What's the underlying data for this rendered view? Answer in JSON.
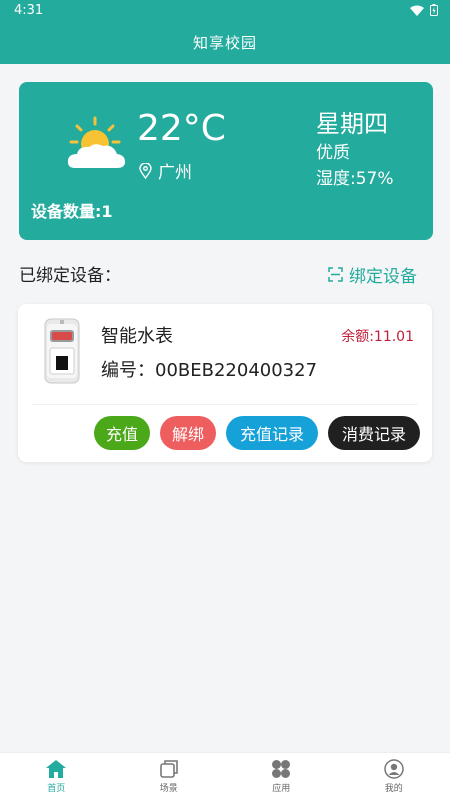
{
  "status_bar": {
    "time": "4:31"
  },
  "app": {
    "title": "知享校园"
  },
  "weather": {
    "temperature": "22°C",
    "location": "广州",
    "weekday": "星期四",
    "air_quality": "优质",
    "humidity": "湿度:57%",
    "device_count": "设备数量:1"
  },
  "bound_section": {
    "title": "已绑定设备：",
    "bind_label": "绑定设备"
  },
  "device": {
    "name": "智能水表",
    "balance": "余额:11.01",
    "serial": "编号：00BEB220400327",
    "actions": {
      "recharge": "充值",
      "unbind": "解绑",
      "recharge_record": "充值记录",
      "consume_record": "消费记录"
    }
  },
  "tabs": [
    {
      "label": "首页",
      "icon": "home-icon"
    },
    {
      "label": "场景",
      "icon": "scene-icon"
    },
    {
      "label": "应用",
      "icon": "apps-icon"
    },
    {
      "label": "我的",
      "icon": "profile-icon"
    }
  ],
  "colors": {
    "brand": "#23ab9d",
    "balance": "#c0213c",
    "recharge": "#4aa819",
    "unbind": "#ef5e5e",
    "record": "#16a1d9",
    "consume": "#202020"
  }
}
